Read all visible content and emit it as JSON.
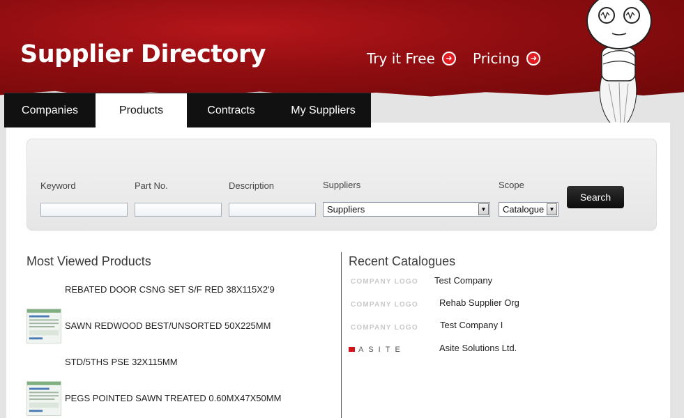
{
  "header": {
    "title": "Supplier Directory",
    "links": [
      {
        "label": "Try it Free"
      },
      {
        "label": "Pricing"
      }
    ]
  },
  "tabs": [
    {
      "label": "Companies",
      "active": false
    },
    {
      "label": "Products",
      "active": true
    },
    {
      "label": "Contracts",
      "active": false
    },
    {
      "label": "My Suppliers",
      "active": false
    }
  ],
  "search": {
    "keyword_label": "Keyword",
    "partno_label": "Part No.",
    "description_label": "Description",
    "suppliers_label": "Suppliers",
    "suppliers_value": "Suppliers",
    "scope_label": "Scope",
    "scope_value": "Catalogue",
    "button_label": "Search"
  },
  "most_viewed": {
    "title": "Most Viewed Products",
    "items": [
      {
        "name": "REBATED DOOR CSNG SET S/F RED 38X115X2'9",
        "has_thumb": false
      },
      {
        "name": "SAWN REDWOOD BEST/UNSORTED 50X225MM",
        "has_thumb": true
      },
      {
        "name": "STD/5THS PSE 32X115MM",
        "has_thumb": false
      },
      {
        "name": "PEGS POINTED SAWN TREATED 0.60MX47X50MM",
        "has_thumb": true
      }
    ]
  },
  "recent_catalogues": {
    "title": "Recent Catalogues",
    "items": [
      {
        "logo": "COMPANY LOGO",
        "name": "Test Company"
      },
      {
        "logo": "COMPANY LOGO",
        "name": "Rehab Supplier Org"
      },
      {
        "logo": "COMPANY LOGO",
        "name": "Test Company I"
      },
      {
        "logo": "ASITE",
        "name": "Asite Solutions Ltd."
      }
    ]
  },
  "colors": {
    "brand_red": "#8f0d10",
    "accent_red": "#e11d22",
    "tab_dark": "#111111"
  }
}
